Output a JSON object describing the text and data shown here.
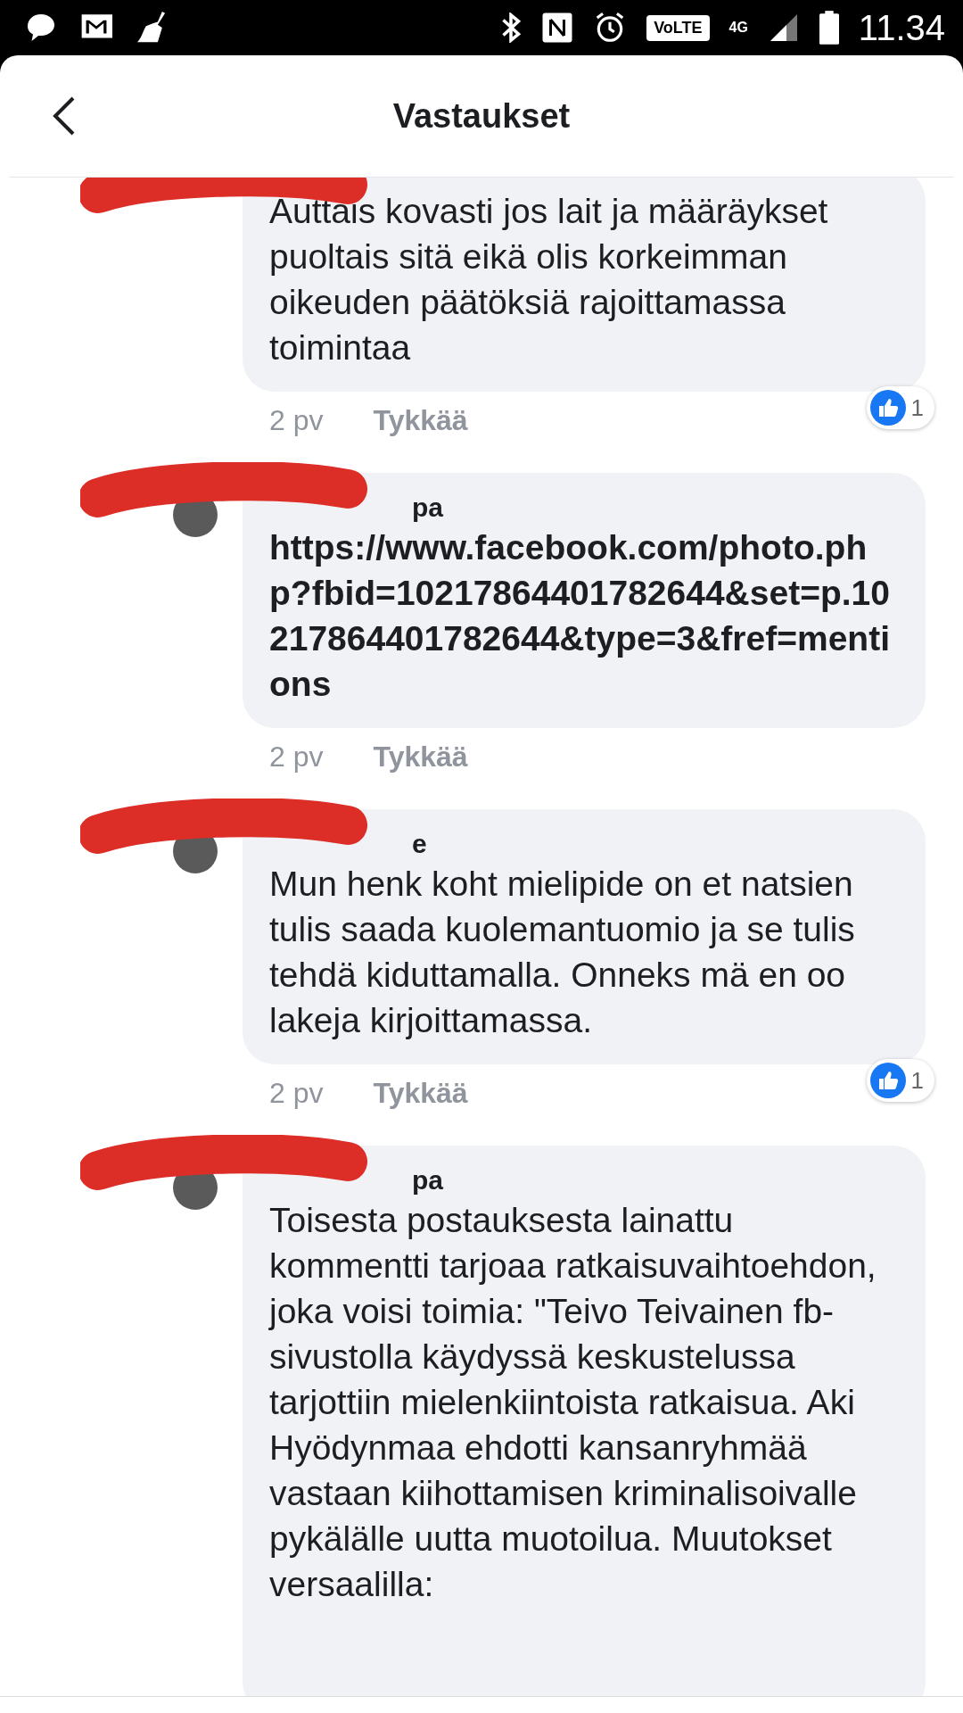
{
  "status_bar": {
    "time": "11.34",
    "volte": "VoLTE",
    "network": "4G"
  },
  "header": {
    "title": "Vastaukset"
  },
  "comments": [
    {
      "text": "Auttais kovasti jos lait ja määräykset puoltais sitä eikä olis korkeimman oikeuden päätöksiä rajoittamassa toimintaa",
      "time": "2 pv",
      "like": "Tykkää",
      "reactions": "1",
      "bold": false
    },
    {
      "author": "pa",
      "text": "https://www.facebook.com/photo.php?fbid=10217864401782644&set=p.10217864401782644&type=3&fref=mentions",
      "time": "2 pv",
      "like": "Tykkää",
      "bold": true
    },
    {
      "author": "e",
      "text": "Mun henk koht mielipide on et natsien tulis saada kuolemantuomio ja se tulis tehdä kiduttamalla. Onneks mä en oo lakeja kirjoittamassa.",
      "time": "2 pv",
      "like": "Tykkää",
      "reactions": "1",
      "bold": false
    },
    {
      "author": "pa",
      "text": "Toisesta postauksesta lainattu kommentti tarjoaa ratkaisuvaihtoehdon, joka voisi toimia: \"Teivo Teivainen fb-sivustolla käydyssä keskustelussa tarjottiin mielenkiintoista ratkaisua. Aki Hyödynmaa ehdotti kansanryhmää vastaan kiihottamisen kriminalisoivalle pykälälle uutta muotoilua. Muutokset versaalilla:",
      "bold": false
    }
  ]
}
